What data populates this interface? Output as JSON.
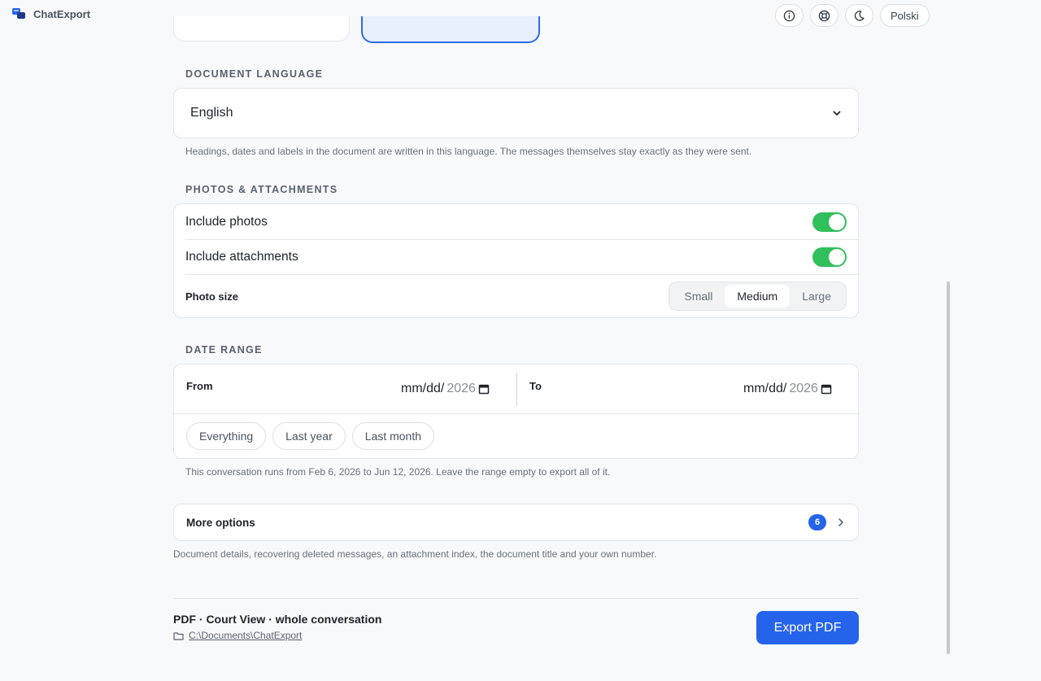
{
  "app": {
    "name": "ChatExport"
  },
  "header": {
    "language_button": "Polski",
    "icons": [
      "info-icon",
      "help-icon",
      "moon-icon"
    ]
  },
  "document_language": {
    "title": "DOCUMENT LANGUAGE",
    "selected": "English",
    "hint": "Headings, dates and labels in the document are written in this language. The messages themselves stay exactly as they were sent."
  },
  "photos": {
    "title": "PHOTOS & ATTACHMENTS",
    "include_photos_label": "Include photos",
    "include_photos_on": true,
    "include_attachments_label": "Include attachments",
    "include_attachments_on": true,
    "photo_size_label": "Photo size",
    "photo_size_options": [
      "Small",
      "Medium",
      "Large"
    ],
    "photo_size_selected": "Medium"
  },
  "date_range": {
    "title": "DATE RANGE",
    "from_label": "From",
    "from_value_prefix": "mm/dd/",
    "from_value_year": "2026",
    "to_label": "To",
    "to_value_prefix": "mm/dd/",
    "to_value_year": "2026",
    "presets": [
      "Everything",
      "Last year",
      "Last month"
    ],
    "hint": "This conversation runs from Feb 6, 2026 to Jun 12, 2026. Leave the range empty to export all of it."
  },
  "more_options": {
    "label": "More options",
    "count": "6",
    "hint": "Document details, recovering deleted messages, an attachment index, the document title and your own number."
  },
  "footer": {
    "summary": "PDF · Court View · whole conversation",
    "path": "C:\\Documents\\ChatExport",
    "export_label": "Export PDF"
  },
  "colors": {
    "accent": "#2563eb",
    "toggle_on": "#2fbf5b"
  }
}
